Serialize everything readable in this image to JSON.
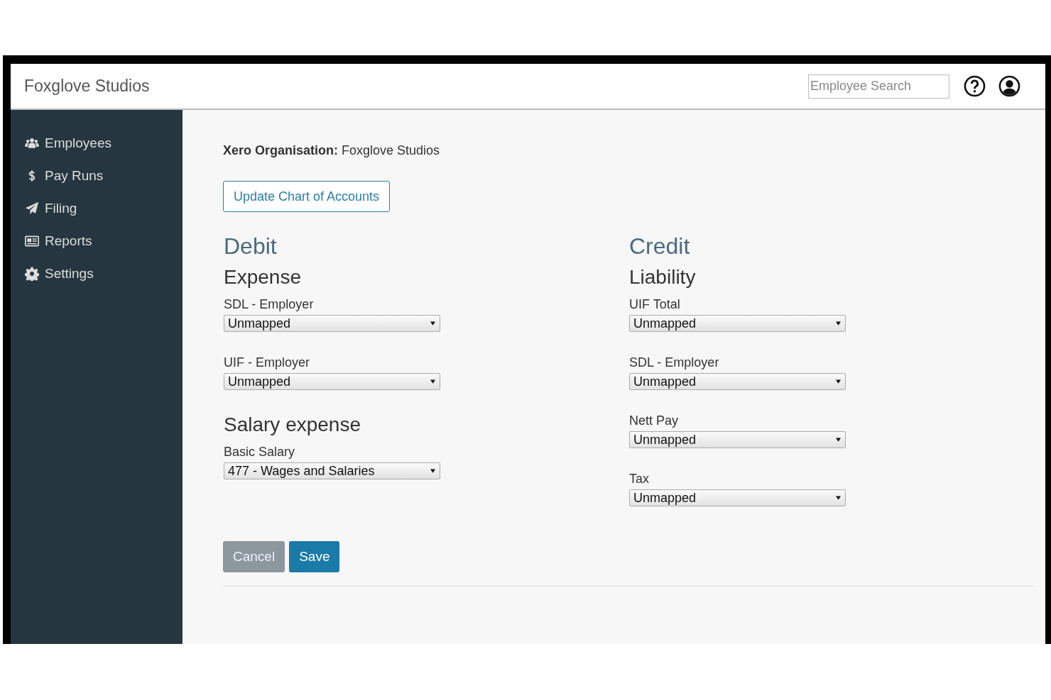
{
  "header": {
    "brand": "Foxglove Studios",
    "search": {
      "placeholder": "Employee Search"
    }
  },
  "sidebar": {
    "items": [
      {
        "label": "Employees",
        "kind": "users"
      },
      {
        "label": "Pay Runs",
        "kind": "dollar"
      },
      {
        "label": "Filing",
        "kind": "send"
      },
      {
        "label": "Reports",
        "kind": "report"
      },
      {
        "label": "Settings",
        "kind": "gear"
      }
    ]
  },
  "content": {
    "organisation": "**Xero Organisation:** Foxglove Studios",
    "update_button": "Update Chart of Accounts",
    "columns": [
      {
        "title": "Debit",
        "groups": [
          {
            "title": "Expense",
            "fields": [
              {
                "label": "SDL - Employer",
                "value": "Unmapped"
              },
              {
                "label": "UIF - Employer",
                "value": "Unmapped"
              }
            ]
          },
          {
            "title": "Salary expense",
            "fields": [
              {
                "label": "Basic Salary",
                "value": "477 - Wages and Salaries"
              }
            ]
          }
        ]
      },
      {
        "title": "Credit",
        "groups": [
          {
            "title": "Liability",
            "fields": [
              {
                "label": "UIF Total",
                "value": "Unmapped"
              },
              {
                "label": "SDL - Employer",
                "value": "Unmapped"
              },
              {
                "label": "Nett Pay",
                "value": "Unmapped"
              },
              {
                "label": "Tax",
                "value": "Unmapped"
              }
            ]
          }
        ]
      }
    ],
    "buttons": [
      {
        "label": "Cancel",
        "kind": "secondary"
      },
      {
        "label": "Save",
        "kind": "primary"
      }
    ]
  }
}
